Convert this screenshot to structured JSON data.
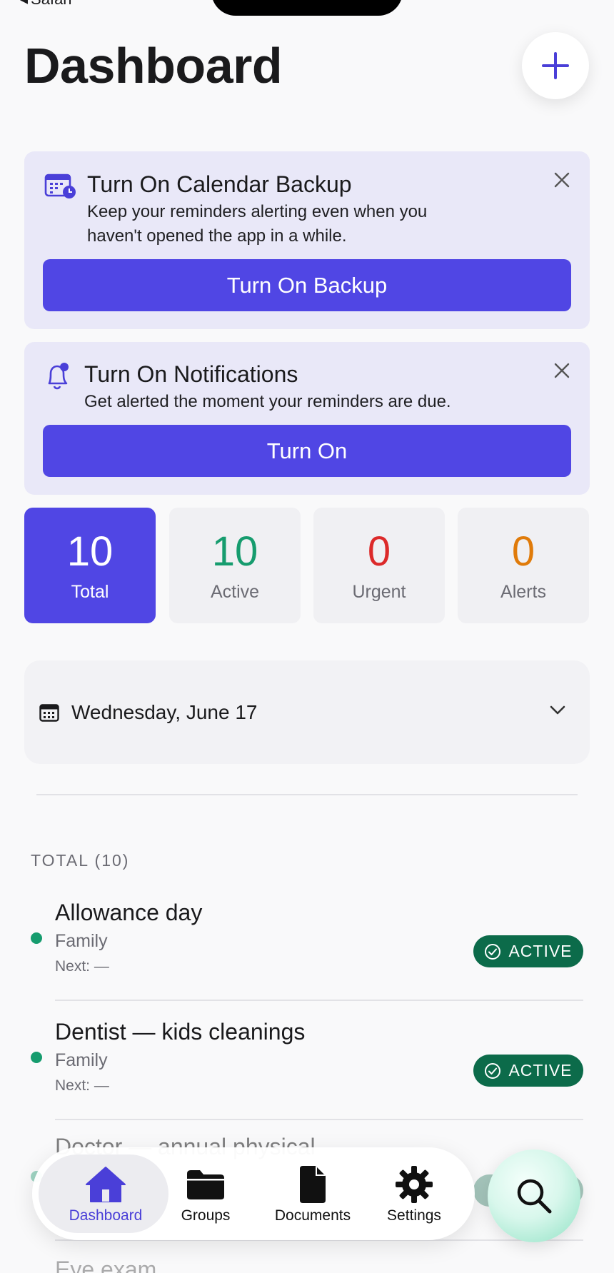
{
  "status_bar": {
    "back_label": "Safari"
  },
  "header": {
    "title": "Dashboard",
    "add_icon": "plus-icon"
  },
  "banners": {
    "calendar": {
      "icon": "calendar-clock-icon",
      "title": "Turn On Calendar Backup",
      "body_line1": "Keep your reminders alerting even when you",
      "body_line2": "haven't opened the app in a while.",
      "cta": "Turn On Backup"
    },
    "notifications": {
      "icon": "bell-icon",
      "title": "Turn On Notifications",
      "body": "Get alerted the moment your reminders are due.",
      "cta": "Turn On"
    }
  },
  "stats": [
    {
      "value": "10",
      "label": "Total",
      "color": "#ffffff"
    },
    {
      "value": "10",
      "label": "Active",
      "color": "#169c6e"
    },
    {
      "value": "0",
      "label": "Urgent",
      "color": "#dc2a2a"
    },
    {
      "value": "0",
      "label": "Alerts",
      "color": "#e07b0a"
    }
  ],
  "date_picker": {
    "label": "Wednesday, June 17"
  },
  "section": {
    "header": "TOTAL (10)"
  },
  "reminders": [
    {
      "title": "Allowance day",
      "group": "Family",
      "next": "Next: —",
      "status": "ACTIVE"
    },
    {
      "title": "Dentist — kids cleanings",
      "group": "Family",
      "next": "Next: —",
      "status": "ACTIVE"
    }
  ],
  "partial_items": {
    "title_1": "Doctor — annual physical",
    "title_2": "Eye exam"
  },
  "tab_bar": {
    "tabs": [
      {
        "label": "Dashboard",
        "icon": "house-icon"
      },
      {
        "label": "Groups",
        "icon": "folder-icon"
      },
      {
        "label": "Documents",
        "icon": "document-icon"
      },
      {
        "label": "Settings",
        "icon": "gear-icon"
      }
    ],
    "active": "Dashboard"
  },
  "colors": {
    "accent": "#5046e4",
    "banner_bg": "#e9e8f8",
    "active_green": "#169c6e",
    "badge_green": "#0c6b4a",
    "urgent_red": "#dc2a2a",
    "alerts_orange": "#e07b0a"
  }
}
